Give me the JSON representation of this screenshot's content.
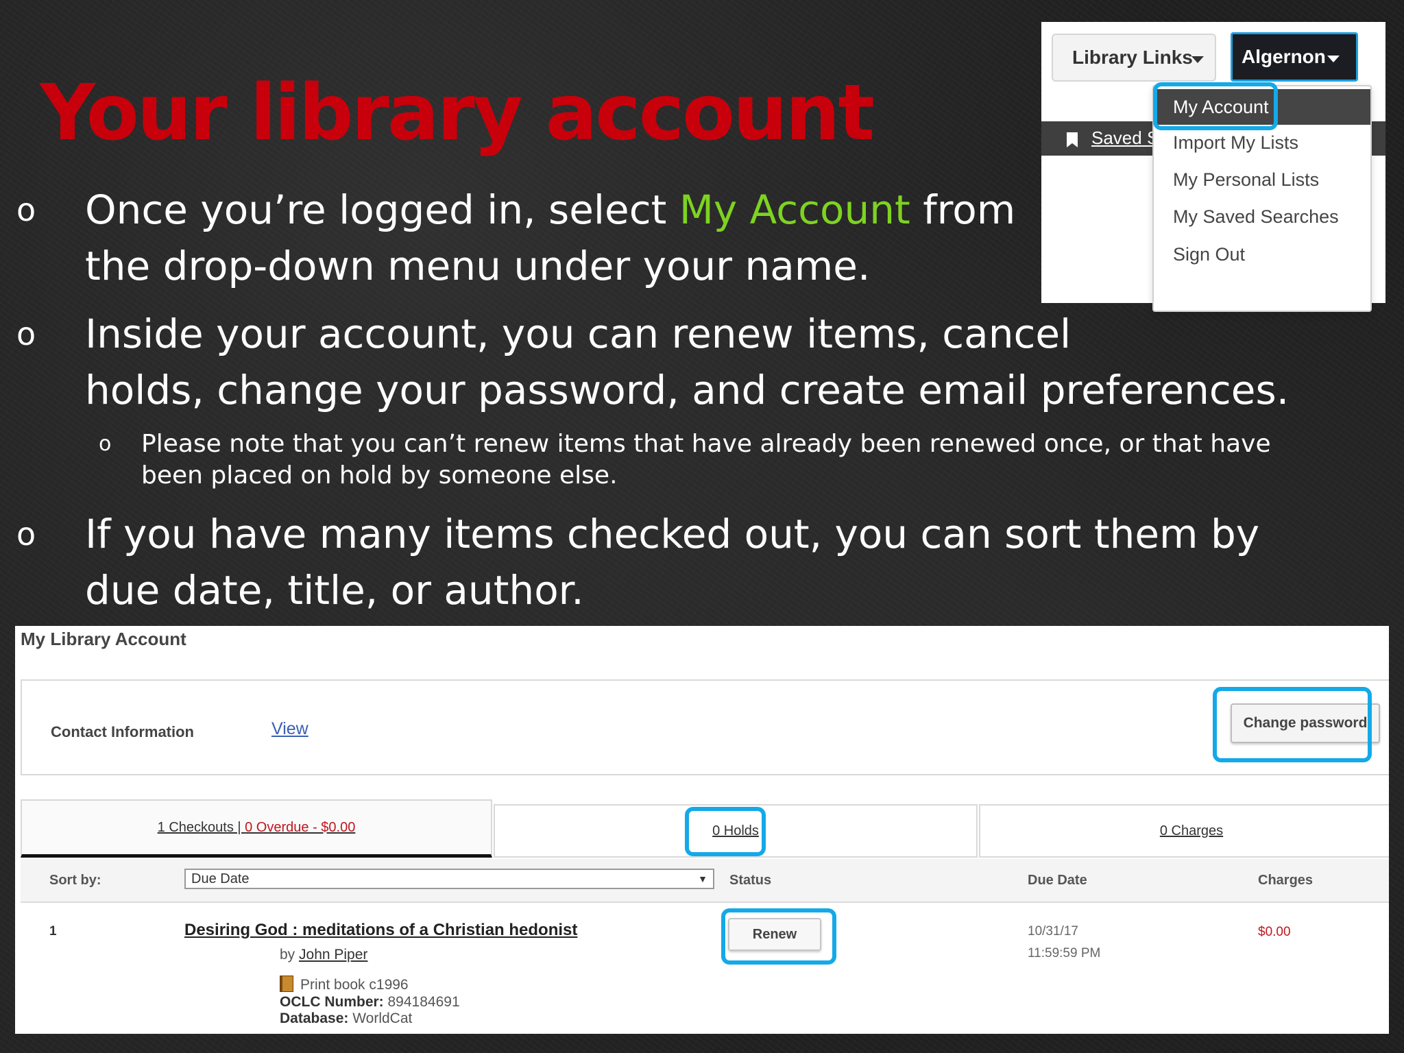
{
  "slide": {
    "title": "Your library account",
    "bullets": [
      {
        "line1_pre": "Once you’re logged in, select ",
        "line1_accent": "My Account",
        "line1_post": " from",
        "line2": "the drop-down menu under your name."
      },
      {
        "line1": "Inside your account, you can renew items, cancel",
        "line2": "holds, change your password, and create email preferences."
      },
      {
        "line1": "If you have many items checked out, you can sort them by",
        "line2": "due date, title, or author."
      }
    ],
    "sub_bullet": {
      "line1": "Please note that you can’t renew items that have already been renewed once, or that have",
      "line2": "been placed on hold by someone else."
    },
    "bullet_mark": "o",
    "accent_color": "#7ed321",
    "title_color": "#c8000b",
    "highlight_color": "#14a9e8"
  },
  "menu": {
    "library_links": "Library Links",
    "user_name": "Algernon",
    "saved_partial": "Saved S",
    "items": [
      "My Account",
      "Import My Lists",
      "My Personal Lists",
      "My Saved Searches",
      "Sign Out"
    ]
  },
  "account": {
    "title": "My Library Account",
    "contact_label": "Contact Information",
    "contact_view": "View",
    "change_password": "Change password",
    "tabs": {
      "checkouts": "1 Checkouts | ",
      "overdue": "0 Overdue - $0.00",
      "holds": "0 Holds",
      "charges": "0 Charges"
    },
    "sort_label": "Sort by:",
    "sort_value": "Due Date",
    "columns": {
      "status": "Status",
      "due_date": "Due Date",
      "charges": "Charges"
    },
    "item": {
      "number": "1",
      "title": "Desiring God : meditations of a Christian hedonist",
      "by_prefix": "by ",
      "author": "John Piper",
      "type": "Print book c1996",
      "oclc_label": "OCLC Number:",
      "oclc_value": " 894184691",
      "db_label": "Database:",
      "db_value": " WorldCat",
      "renew_label": "Renew",
      "due_date": "10/31/17",
      "due_time": "11:59:59 PM",
      "charge": "$0.00"
    }
  }
}
